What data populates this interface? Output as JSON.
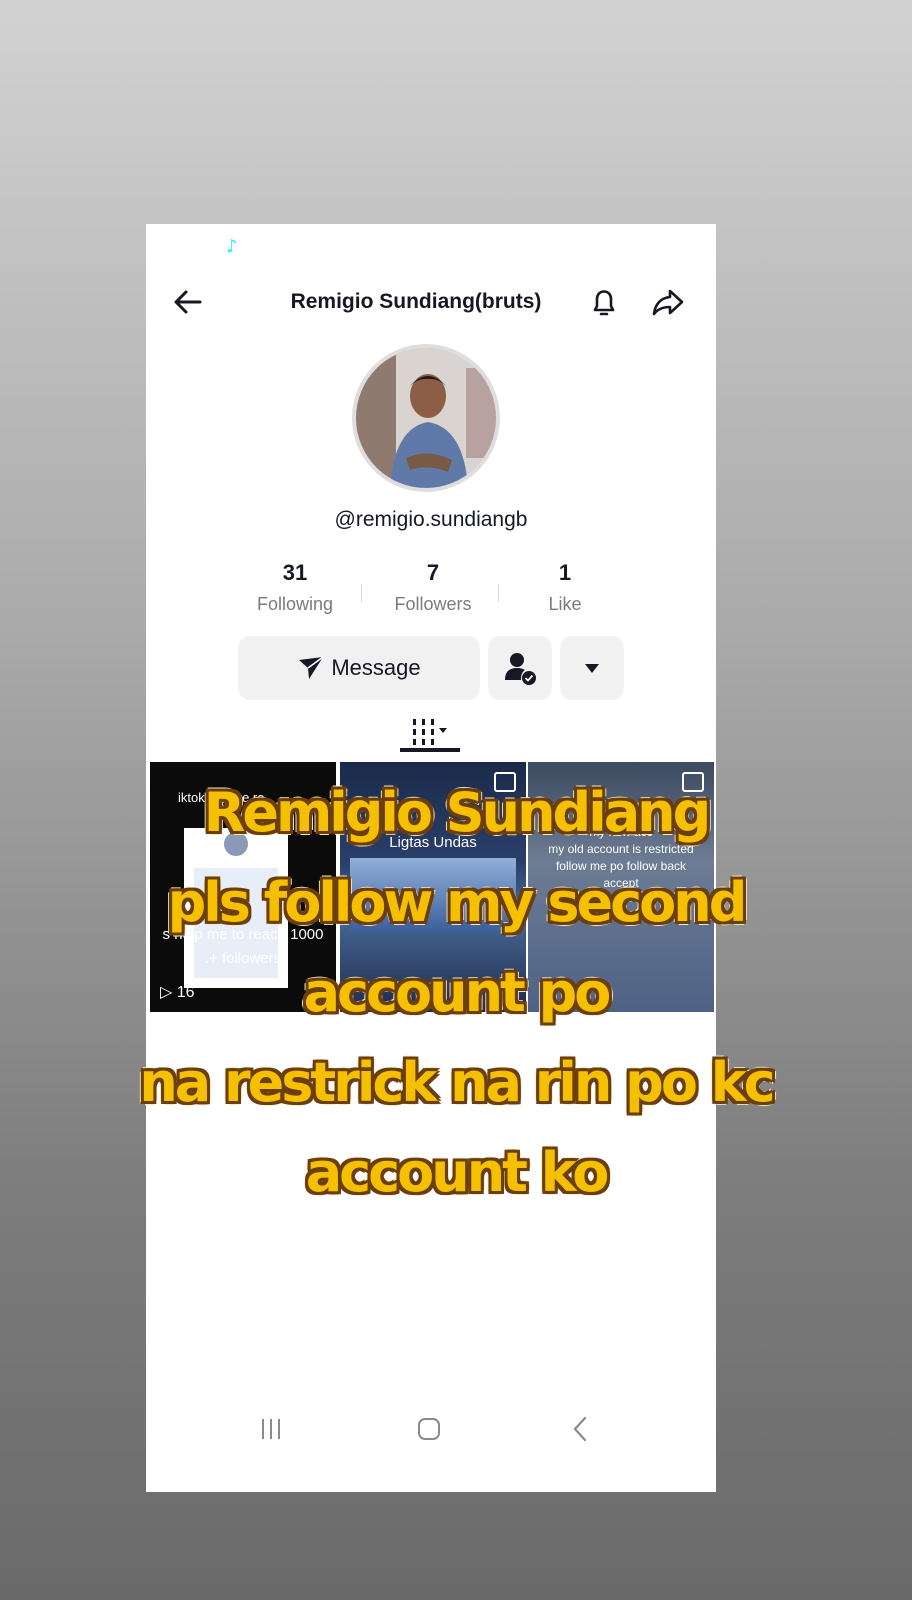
{
  "profile": {
    "title": "Remigio Sundiang(bruts)",
    "username": "@remigio.sundiangb"
  },
  "stats": [
    {
      "value": "31",
      "label": "Following"
    },
    {
      "value": "7",
      "label": "Followers"
    },
    {
      "value": "1",
      "label": "Like"
    }
  ],
  "actions": {
    "message_label": "Message"
  },
  "videos": [
    {
      "text_top": "iktok affiliate re",
      "text_mid": "ow",
      "text_bottom": "s help me to reach 1000",
      "text_last": ".+ followers",
      "views": "16"
    },
    {
      "title": "Ligtas Undas"
    },
    {
      "text": "my new acc\nmy old account is restricted\nfollow me po follow back\naccept"
    }
  ],
  "overlay_caption": [
    "Remigio Sundiang",
    "pls follow my second",
    "account po",
    "na restrick na rin po kc",
    "account ko"
  ],
  "colors": {
    "caption_fill": "#f5c000",
    "caption_outline": "#6b3e0d",
    "text_primary": "#161823",
    "text_secondary": "#7a7b80",
    "button_bg": "#f1f1f2"
  }
}
